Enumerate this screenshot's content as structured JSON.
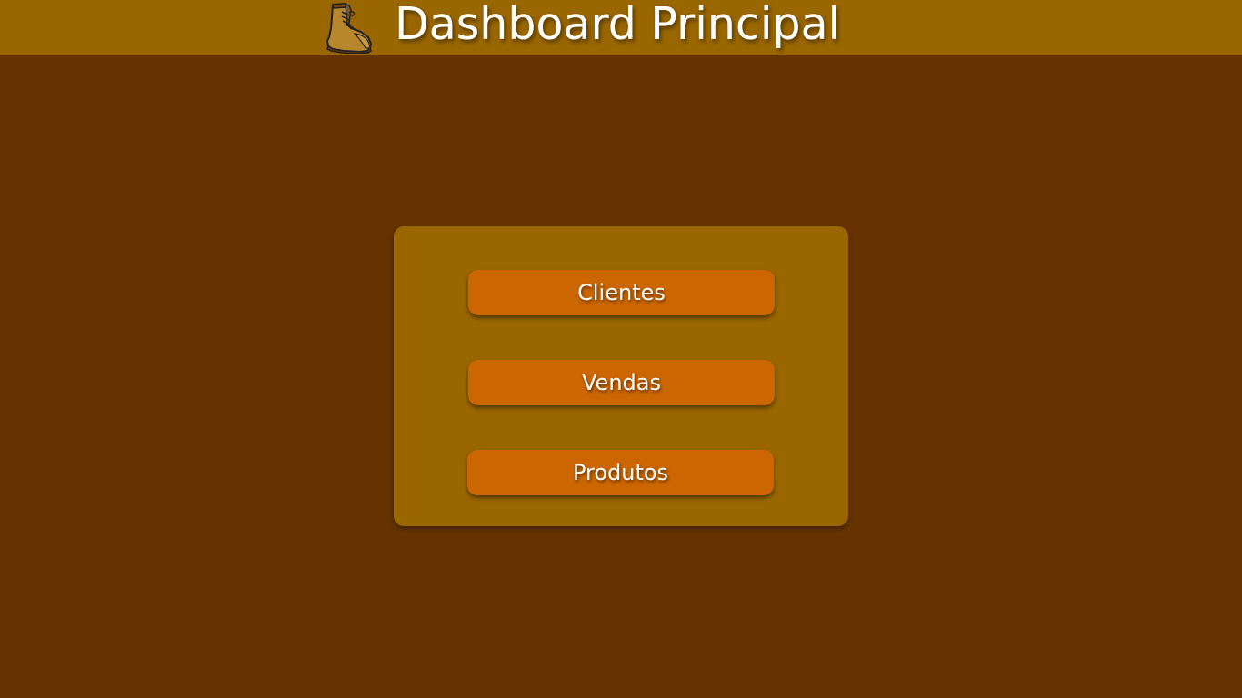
{
  "header": {
    "title": "Dashboard Principal",
    "logo_icon": "boot-icon",
    "background_color": "#996600"
  },
  "page": {
    "background_color": "#663300"
  },
  "menu": {
    "panel_color": "#996600",
    "button_color": "#cc6600",
    "buttons": [
      {
        "label": "Clientes"
      },
      {
        "label": "Vendas"
      },
      {
        "label": "Produtos"
      }
    ]
  }
}
